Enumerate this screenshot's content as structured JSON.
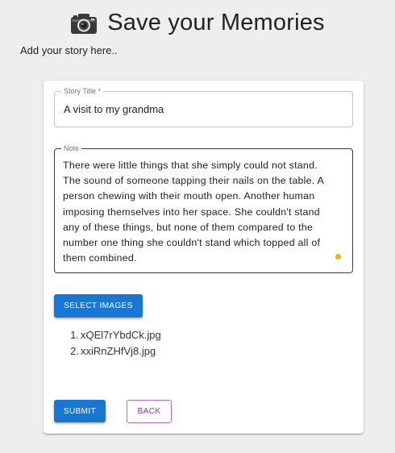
{
  "header": {
    "title": "Save your Memories",
    "icon": "camera-icon"
  },
  "subtitle": "Add your story here..",
  "form": {
    "title_field": {
      "label": "Story Title *",
      "value": "A visit to my grandma"
    },
    "note_field": {
      "label": "Note",
      "value": "There were little things that she simply could not stand. The sound of someone tapping their nails on the table. A person chewing with their mouth open. Another human imposing themselves into her space. She couldn't stand any of these things, but none of them compared to the number one thing she couldn't stand which topped all of them combined."
    },
    "select_images_label": "Select Images",
    "files": [
      {
        "index": "1.",
        "name": "xQEl7rYbdCk.jpg"
      },
      {
        "index": "2.",
        "name": "xxiRnZHfVj8.jpg"
      }
    ],
    "submit_label": "Submit",
    "back_label": "Back"
  },
  "colors": {
    "primary": "#1976d2",
    "secondary": "#9c27b0",
    "background": "#eeeeee",
    "focus_dot": "#f5b400"
  }
}
